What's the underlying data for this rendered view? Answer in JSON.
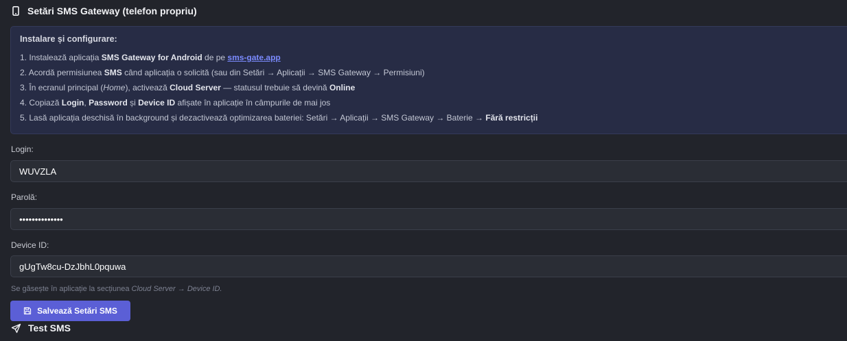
{
  "section": {
    "title": "Setări SMS Gateway (telefon propriu)",
    "icon": "phone-icon"
  },
  "instructions": {
    "heading": "Instalare și configurare:",
    "steps": [
      {
        "num": "1.",
        "t1": "Instalează aplicația",
        "b1": "SMS Gateway for Android",
        "t2": "de pe",
        "link": "sms-gate.app"
      },
      {
        "num": "2.",
        "t1": "Acordă permisiunea",
        "b1": "SMS",
        "t2": "când aplicația o solicită (sau din Setări → Aplicații → SMS Gateway → Permisiuni)"
      },
      {
        "num": "3.",
        "t1": "În ecranul principal (",
        "i1": "Home",
        "t2": "), activează",
        "b1": "Cloud Server",
        "t3": "— statusul trebuie să devină",
        "b2": "Online"
      },
      {
        "num": "4.",
        "t1": "Copiază",
        "b1": "Login",
        "t2": ",",
        "b2": "Password",
        "t3": "și",
        "b3": "Device ID",
        "t4": "afișate în aplicație în câmpurile de mai jos"
      },
      {
        "num": "5.",
        "t1": "Lasă aplicația deschisă în background și dezactivează optimizarea bateriei: Setări → Aplicații → SMS Gateway → Baterie →",
        "b1": "Fără restricții"
      }
    ]
  },
  "form": {
    "login_label": "Login:",
    "login_value": "WUVZLA",
    "password_label": "Parolă:",
    "password_value": "••••••••••••••",
    "device_label": "Device ID:",
    "device_value": "gUgTw8cu-DzJbhL0pquwa",
    "hint_prefix": "Se găsește în aplicație la secțiunea",
    "hint_italic": "Cloud Server → Device ID."
  },
  "save_button": {
    "label": "Salvează Setări SMS",
    "icon": "floppy-disk-icon"
  },
  "test_section": {
    "title": "Test SMS",
    "icon": "send-icon"
  },
  "colors": {
    "background": "#22242b",
    "info_box": "#272c45",
    "accent": "#5b5fd6",
    "link": "#7b8bff"
  }
}
